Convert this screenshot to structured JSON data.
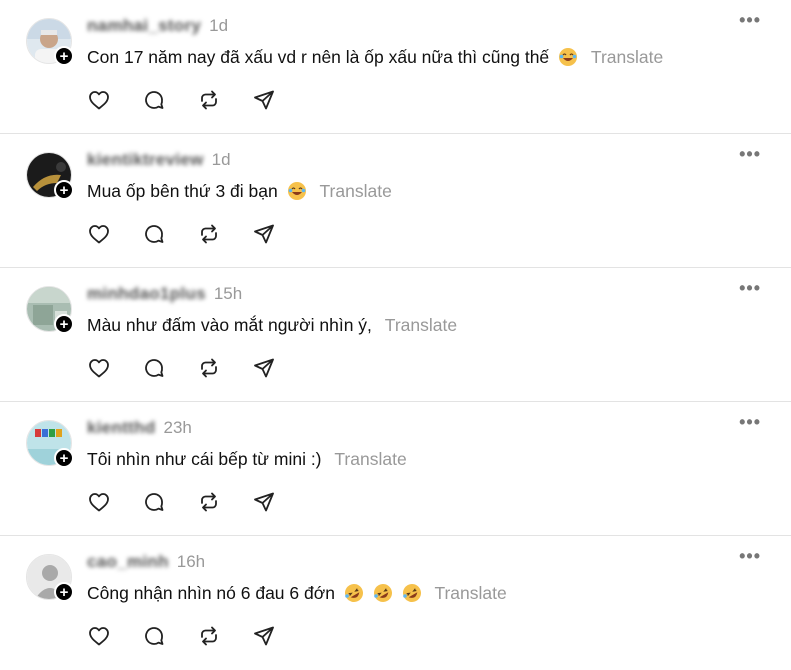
{
  "translate_label": "Translate",
  "comments": [
    {
      "username": "namhai_story",
      "time": "1d",
      "text": "Con 17 năm nay đã xấu vd r nên là ốp xấu nữa thì cũng thế",
      "emojis": [
        "tears-of-joy"
      ],
      "avatar": "person-photo"
    },
    {
      "username": "kientiktreview",
      "time": "1d",
      "text": "Mua ốp bên thứ 3 đi bạn",
      "emojis": [
        "tears-of-joy"
      ],
      "avatar": "dark-photo"
    },
    {
      "username": "minhdao1plus",
      "time": "15h",
      "text": "Màu như đấm vào mắt người nhìn ý,",
      "emojis": [],
      "avatar": "green-photo"
    },
    {
      "username": "kientthd",
      "time": "23h",
      "text": "Tôi nhìn như cái bếp từ mini :)",
      "emojis": [],
      "avatar": "time-logo"
    },
    {
      "username": "cao_minh",
      "time": "16h",
      "text": "Công nhận nhìn nó 6 đau 6 đớn",
      "emojis": [
        "rofl",
        "rofl",
        "rofl"
      ],
      "avatar": "default-silhouette"
    }
  ]
}
